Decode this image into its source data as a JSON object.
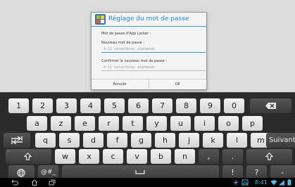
{
  "dialog": {
    "title": "Réglage du mot de passe",
    "subtitle": "Mot de passe d'App Locker :",
    "new_label": "Nouveau mot de passe :",
    "new_placeholder": "4-12 caractères alphanum.",
    "confirm_label": "Confirmer le nouveau mot de passe :",
    "confirm_placeholder": "4-12 caractères alphanum.",
    "cancel_label": "Annuler",
    "ok_label": "OK"
  },
  "keyboard": {
    "row1": [
      "1",
      "2",
      "3",
      "4",
      "5",
      "6",
      "7",
      "8",
      "9",
      "0"
    ],
    "row2": [
      "a",
      "z",
      "e",
      "r",
      "t",
      "y",
      "u",
      "i",
      "o",
      "p"
    ],
    "row3": [
      "q",
      "s",
      "d",
      "f",
      "g",
      "h",
      "j",
      "k",
      "l",
      "m"
    ],
    "row4": [
      "w",
      "x",
      "c",
      "v",
      "b",
      "n",
      ",",
      "."
    ],
    "suivant_label": "Suivant",
    "symbols_label": "@#_",
    "exclaim_label": "!",
    "question_label": "?",
    "dash_label": "-",
    "backspace_icon": "backspace-icon",
    "tab_icon": "tab-icon",
    "shift_icon": "shift-icon",
    "globe_icon": "globe-icon",
    "space_icon": "space-bar-icon"
  },
  "navbar": {
    "clock": "8:41",
    "icons": [
      "back-icon",
      "home-icon",
      "recent-apps-icon",
      "usb-icon",
      "image-icon",
      "wifi-icon",
      "signal-icon",
      "battery-icon"
    ],
    "accent_color": "#4fb8e6"
  },
  "colors": {
    "dialog_accent": "#2b9bd2",
    "keyboard_bg": "#2b2b2b"
  }
}
